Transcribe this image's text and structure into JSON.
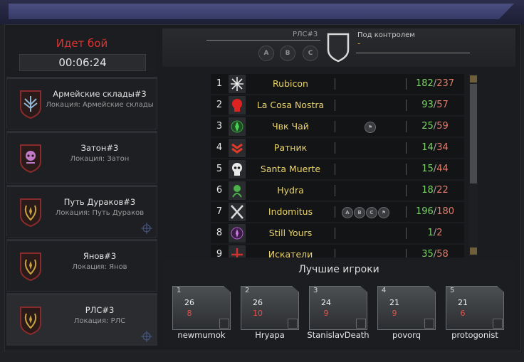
{
  "battle": {
    "title": "Идет бой",
    "timer": "00:06:24"
  },
  "locations": [
    {
      "name": "Армейские склады#3",
      "sub": "Локация: Армейские склады",
      "emblem": "wings-emblem"
    },
    {
      "name": "Затон#3",
      "sub": "Локация: Затон",
      "emblem": "skull-emblem"
    },
    {
      "name": "Путь Дураков#3",
      "sub": "Локация: Путь Дураков",
      "emblem": "laurel-emblem"
    },
    {
      "name": "Янов#3",
      "sub": "Локация: Янов",
      "emblem": "laurel-emblem"
    },
    {
      "name": "РЛС#3",
      "sub": "Локация: РЛС",
      "emblem": "laurel-emblem"
    }
  ],
  "status": {
    "location": "РЛС#3",
    "control_label": "Под контролем",
    "control_value": "-",
    "captures": [
      "A",
      "B",
      "C"
    ]
  },
  "clans": [
    {
      "rank": "1",
      "name": "Rubicon",
      "kills": "182",
      "deaths": "237",
      "caps": []
    },
    {
      "rank": "2",
      "name": "La Cosa Nostra",
      "kills": "93",
      "deaths": "57",
      "caps": []
    },
    {
      "rank": "3",
      "name": "Чвк Чай",
      "kills": "25",
      "deaths": "59",
      "caps": [
        "flag"
      ]
    },
    {
      "rank": "4",
      "name": "Ратник",
      "kills": "14",
      "deaths": "34",
      "caps": []
    },
    {
      "rank": "5",
      "name": "Santa Muerte",
      "kills": "15",
      "deaths": "44",
      "caps": []
    },
    {
      "rank": "6",
      "name": "Hydra",
      "kills": "18",
      "deaths": "22",
      "caps": []
    },
    {
      "rank": "7",
      "name": "Indomitus",
      "kills": "196",
      "deaths": "180",
      "caps": [
        "A",
        "B",
        "C",
        "flag"
      ]
    },
    {
      "rank": "8",
      "name": "Still Yours",
      "kills": "1",
      "deaths": "2",
      "caps": []
    },
    {
      "rank": "9",
      "name": "Искатели",
      "kills": "35",
      "deaths": "58",
      "caps": []
    }
  ],
  "best_players": {
    "title": "Лучшие игроки",
    "players": [
      {
        "num": "1",
        "kills": "26",
        "deaths": "8",
        "name": "newmumok"
      },
      {
        "num": "2",
        "kills": "26",
        "deaths": "10",
        "name": "Hryapa"
      },
      {
        "num": "3",
        "kills": "24",
        "deaths": "9",
        "name": "StanislavDeath"
      },
      {
        "num": "4",
        "kills": "21",
        "deaths": "9",
        "name": "povorq"
      },
      {
        "num": "5",
        "kills": "21",
        "deaths": "6",
        "name": "protogonist"
      }
    ]
  },
  "colors": {
    "accent_red": "#e0322f",
    "clan_name": "#e9d36a",
    "kills": "#7fd06a",
    "deaths": "#e77a66"
  }
}
